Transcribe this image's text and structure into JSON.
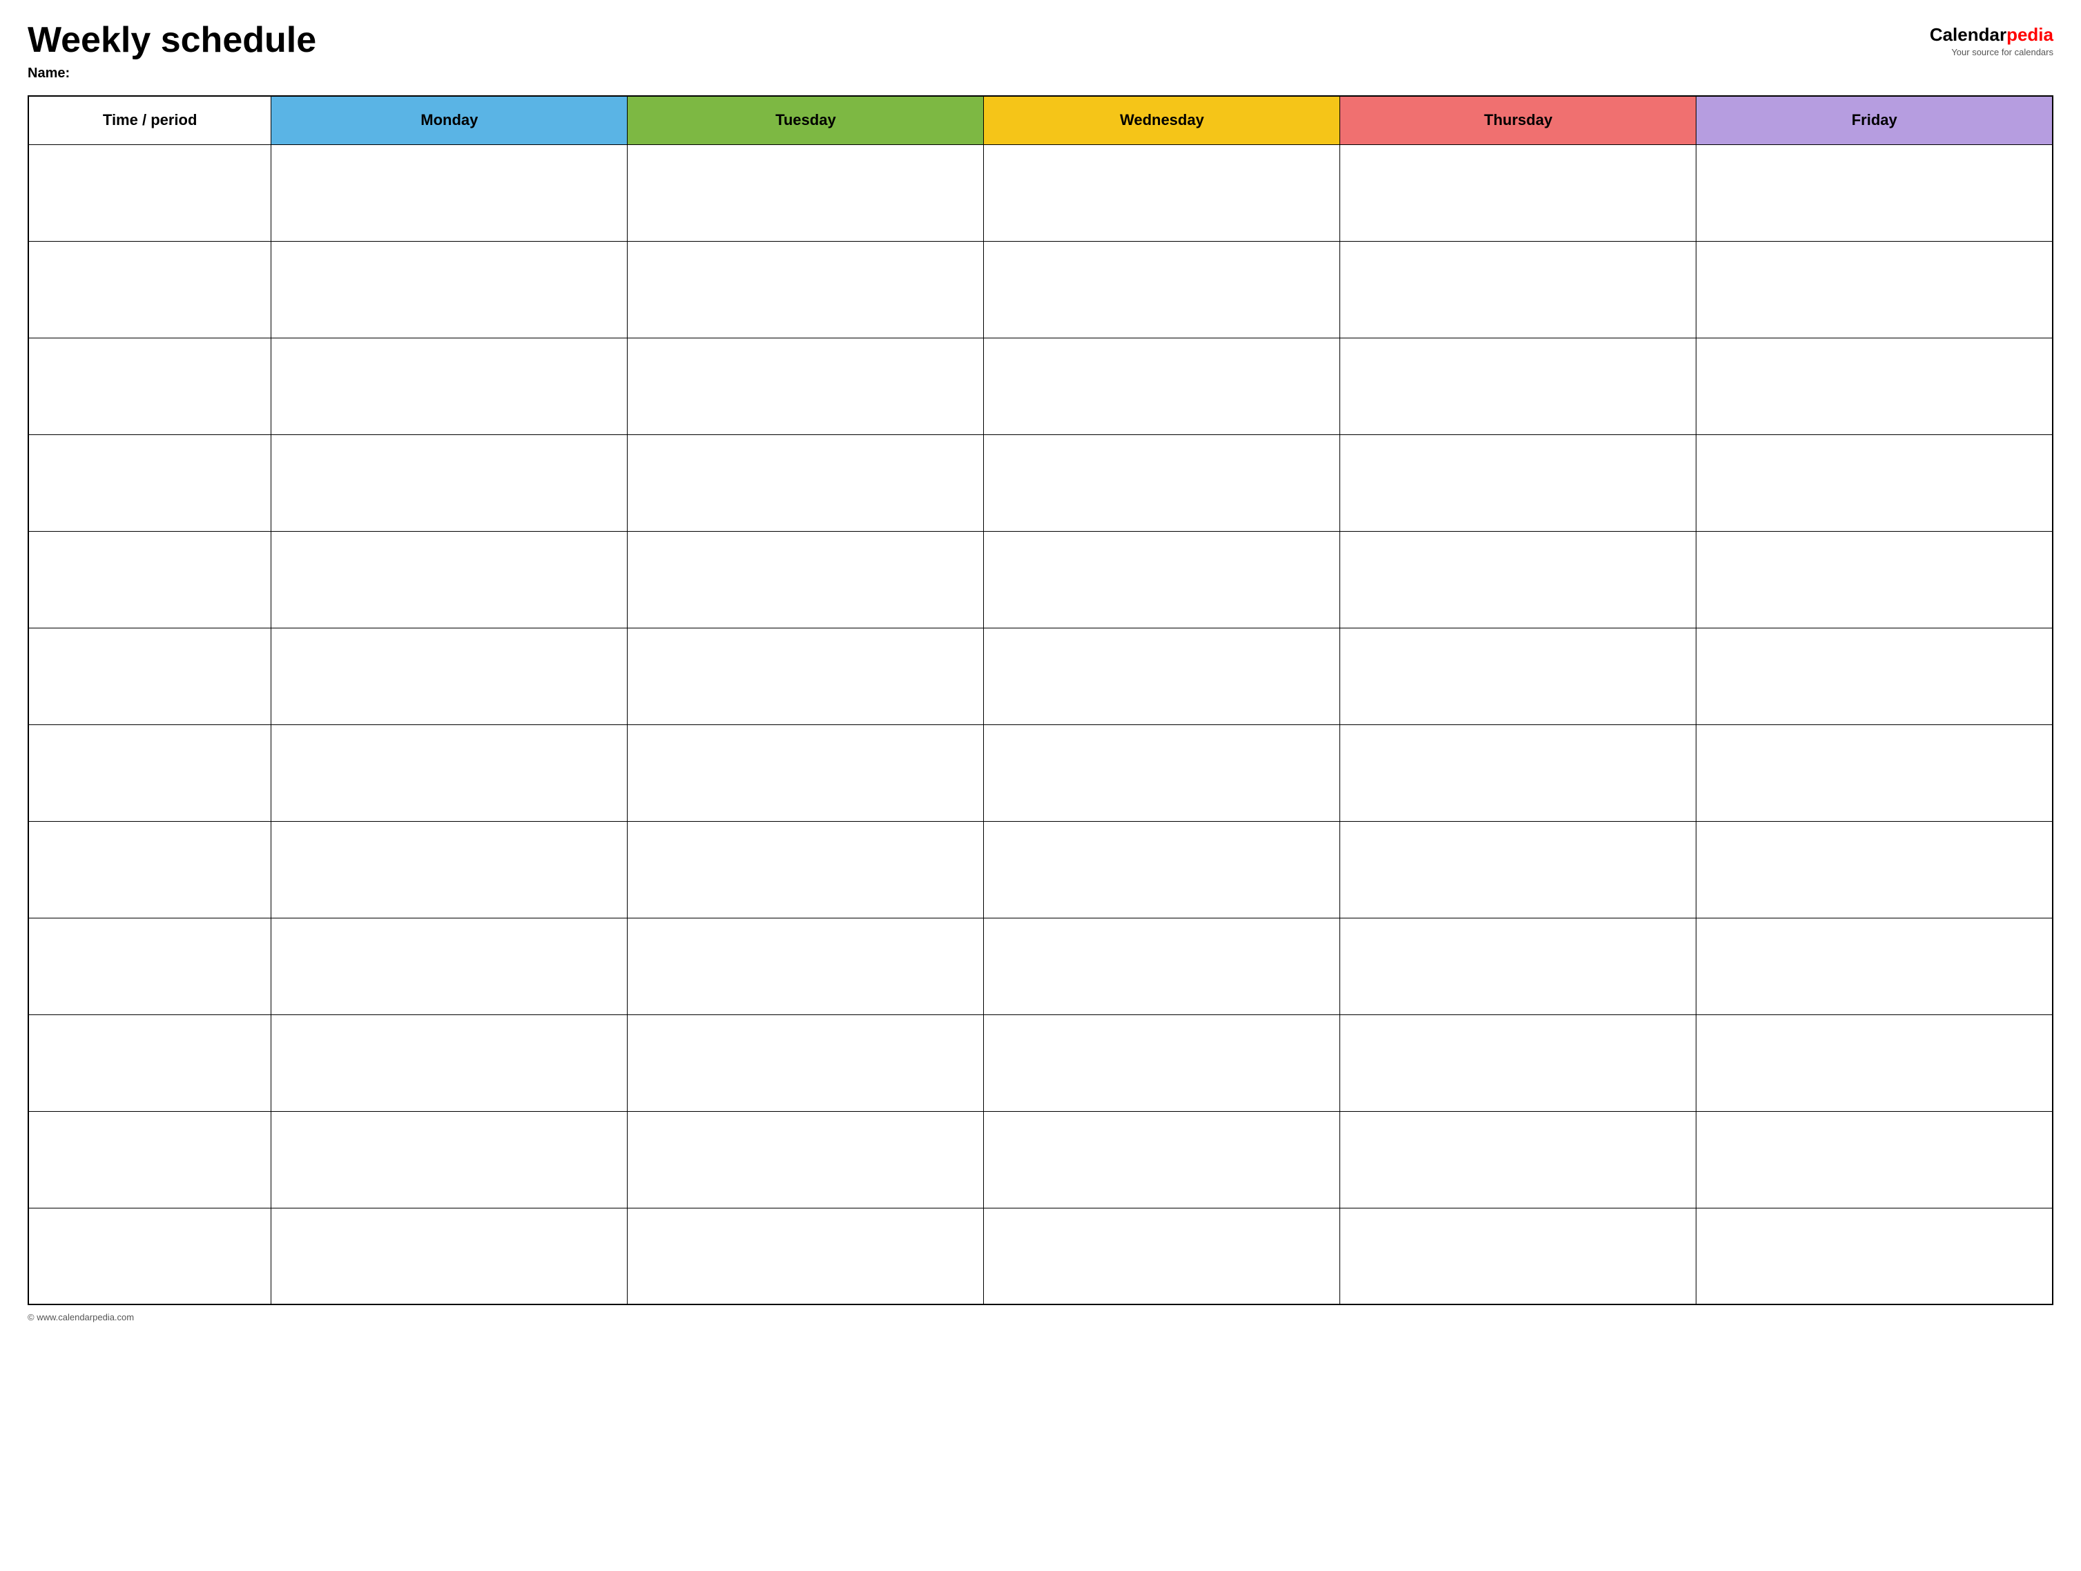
{
  "header": {
    "title": "Weekly schedule",
    "name_label": "Name:",
    "logo": {
      "calendar_part": "Calendar",
      "pedia_part": "pedia",
      "tagline": "Your source for calendars"
    }
  },
  "table": {
    "columns": [
      {
        "key": "time",
        "label": "Time / period",
        "color": "#ffffff"
      },
      {
        "key": "monday",
        "label": "Monday",
        "color": "#5ab4e5"
      },
      {
        "key": "tuesday",
        "label": "Tuesday",
        "color": "#7db843"
      },
      {
        "key": "wednesday",
        "label": "Wednesday",
        "color": "#f5c518"
      },
      {
        "key": "thursday",
        "label": "Thursday",
        "color": "#f07070"
      },
      {
        "key": "friday",
        "label": "Friday",
        "color": "#b69de0"
      }
    ],
    "row_count": 12
  },
  "footer": {
    "copyright": "© www.calendarpedia.com"
  }
}
